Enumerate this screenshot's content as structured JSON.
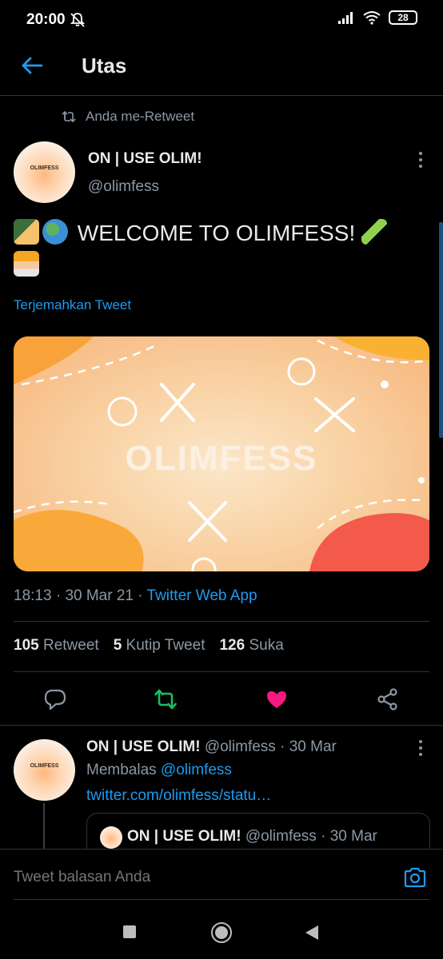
{
  "status": {
    "time": "20:00",
    "battery": "28"
  },
  "header": {
    "title": "Utas"
  },
  "tweet": {
    "retweet_context": "Anda me-Retweet",
    "author_name": "ON | USE OLIM!",
    "author_handle": "@olimfess",
    "avatar_logo_text": "OLIMFESS",
    "text": "WELCOME TO OLIMFESS!",
    "translate_label": "Terjemahkan Tweet",
    "media_title": "OLIMFESS",
    "time": "18:13",
    "date": "30 Mar 21",
    "source": "Twitter Web App",
    "stats": {
      "retweets_count": "105",
      "retweets_label": "Retweet",
      "quotes_count": "5",
      "quotes_label": "Kutip Tweet",
      "likes_count": "126",
      "likes_label": "Suka"
    },
    "colors": {
      "retweeted": "#17bf63",
      "liked": "#f91880",
      "link": "#1d9bf0"
    }
  },
  "reply": {
    "author_name": "ON | USE OLIM!",
    "author_handle": "@olimfess",
    "date": "30 Mar",
    "replying_prefix": "Membalas",
    "replying_to": "@olimfess",
    "link": "twitter.com/olimfess/statu…",
    "quote": {
      "author_name": "ON | USE OLIM!",
      "author_handle": "@olimfess",
      "date": "30 Mar"
    }
  },
  "composer": {
    "placeholder": "Tweet balasan Anda"
  },
  "icons": {
    "back": "arrow-left-icon",
    "camera": "camera-icon",
    "reply": "comment-icon",
    "retweet": "retweet-icon",
    "like": "heart-icon",
    "share": "share-icon"
  }
}
